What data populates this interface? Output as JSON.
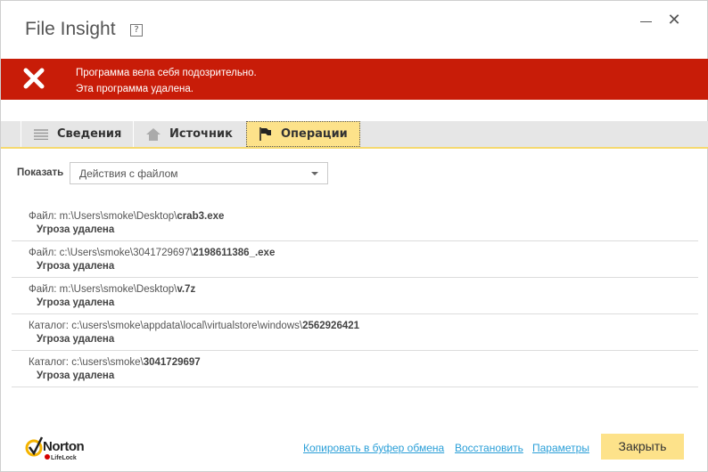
{
  "window": {
    "title": "File Insight",
    "help_label": "?"
  },
  "banner": {
    "line1": "Программа вела себя подозрительно.",
    "line2": "Эта программа удалена.",
    "color": "#c81c08",
    "icon": "x-icon"
  },
  "tabs": [
    {
      "label": "Сведения",
      "icon": "list-icon",
      "active": false
    },
    {
      "label": "Источник",
      "icon": "home-icon",
      "active": false
    },
    {
      "label": "Операции",
      "icon": "flag-icon",
      "active": true
    }
  ],
  "filter": {
    "label": "Показать",
    "value": "Действия с файлом"
  },
  "rows": [
    {
      "prefix": "Файл: m:\\Users\\smoke\\Desktop\\",
      "name": "crab3.exe",
      "status": "Угроза удалена"
    },
    {
      "prefix": "Файл: c:\\Users\\smoke\\3041729697\\",
      "name": "2198611386_.exe",
      "status": "Угроза удалена"
    },
    {
      "prefix": "Файл: m:\\Users\\smoke\\Desktop\\",
      "name": "v.7z",
      "status": "Угроза удалена"
    },
    {
      "prefix": "Каталог: c:\\users\\smoke\\appdata\\local\\virtualstore\\windows\\",
      "name": "2562926421",
      "status": "Угроза удалена"
    },
    {
      "prefix": "Каталог: c:\\users\\smoke\\",
      "name": "3041729697",
      "status": "Угроза удалена"
    }
  ],
  "footer": {
    "logo_text": "Norton",
    "logo_sub": "LifeLock",
    "copy": "Копировать в буфер обмена",
    "restore": "Восстановить",
    "settings": "Параметры",
    "close": "Закрыть"
  }
}
